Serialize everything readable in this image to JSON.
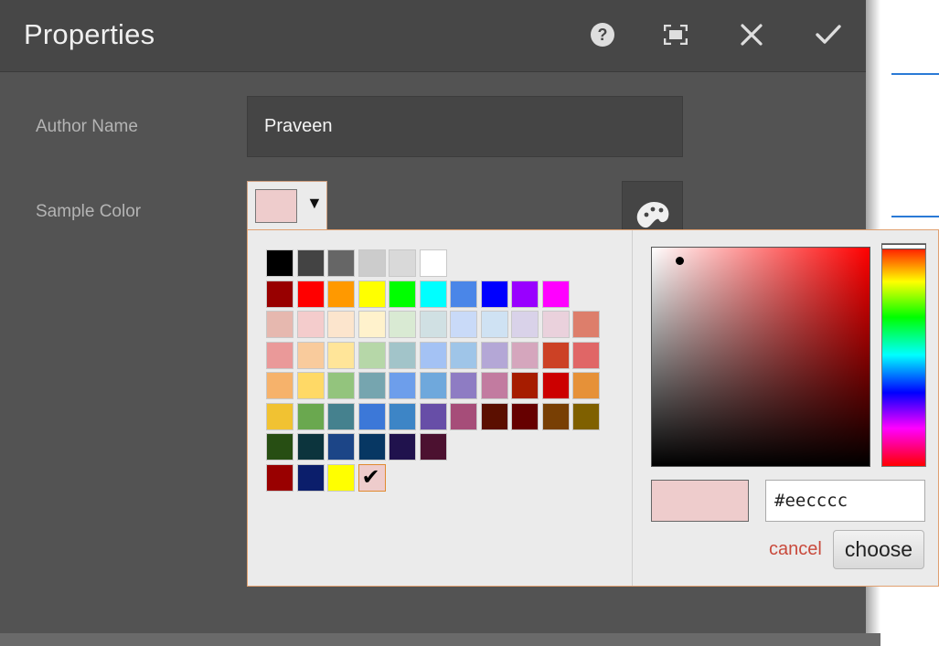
{
  "dialog": {
    "title": "Properties"
  },
  "header_icons": [
    "help-icon",
    "fullscreen-icon",
    "close-icon",
    "check-icon"
  ],
  "form": {
    "author_label": "Author Name",
    "author_value": "Praveen",
    "color_label": "Sample Color",
    "selected_color": "#eecccc"
  },
  "picker": {
    "swatch_rows": [
      [
        "#000000",
        "#434343",
        "#666666",
        "#cccccc",
        "#d9d9d9",
        "#ffffff"
      ],
      [
        "#980000",
        "#ff0000",
        "#ff9900",
        "#ffff00",
        "#00ff00",
        "#00ffff",
        "#4a86e8",
        "#0000ff",
        "#9900ff",
        "#ff00ff"
      ],
      [
        "#e6b8af",
        "#f4cccc",
        "#fce5cd",
        "#fff2cc",
        "#d9ead3",
        "#d0e0e3",
        "#c9daf8",
        "#cfe2f3",
        "#d9d2e9",
        "#ead1dc",
        "#dd7e6b"
      ],
      [
        "#ea9999",
        "#f9cb9c",
        "#ffe599",
        "#b6d7a8",
        "#a2c4c9",
        "#a4c2f4",
        "#9fc5e8",
        "#b4a7d6",
        "#d5a6bd",
        "#cc4125",
        "#e06666"
      ],
      [
        "#f6b26b",
        "#ffd966",
        "#93c47d",
        "#76a5af",
        "#6d9eeb",
        "#6fa8dc",
        "#8e7cc3",
        "#c27ba0",
        "#a61c00",
        "#cc0000",
        "#e69138"
      ],
      [
        "#f1c232",
        "#6aa84f",
        "#45818e",
        "#3c78d8",
        "#3d85c6",
        "#674ea7",
        "#a64d79",
        "#5b0f00",
        "#660000",
        "#783f04",
        "#7f6000"
      ],
      [
        "#274e13",
        "#0c343d",
        "#1c4587",
        "#073763",
        "#20124d",
        "#4c1130"
      ],
      [
        "#990000",
        "#0b1e6b",
        "#ffff00",
        "#eecccc"
      ]
    ],
    "hue": "#ff0000",
    "hex_value": "#eecccc",
    "cancel_label": "cancel",
    "choose_label": "choose"
  },
  "colors": {
    "dialog_bg": "#535353",
    "header_bg": "#474747",
    "accent_blue": "#2a7ad6",
    "popover_border": "#e0a070"
  }
}
